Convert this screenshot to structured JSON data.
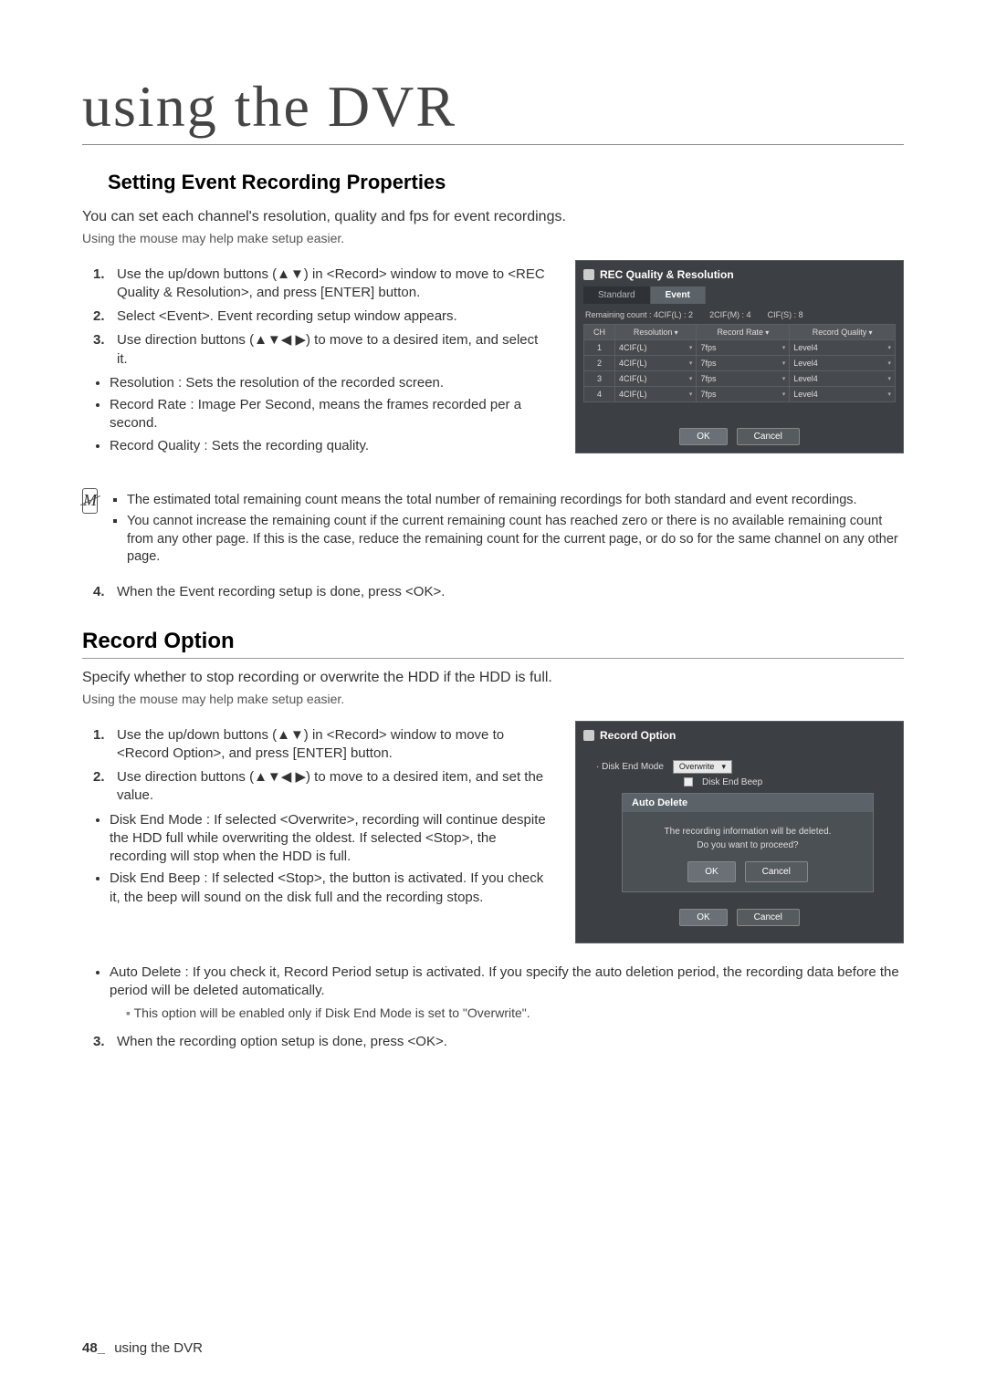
{
  "page": {
    "title": "using the DVR",
    "footer_page": "48_",
    "footer_text": "using the DVR"
  },
  "section1": {
    "heading": "Setting Event Recording Properties",
    "intro": "You can set each channel's resolution, quality and fps for event recordings.",
    "mouse_note": "Using the mouse may help make setup easier.",
    "steps": [
      {
        "n": "1.",
        "text": "Use the up/down buttons (▲▼) in <Record> window to move to <REC Quality & Resolution>, and press [ENTER] button."
      },
      {
        "n": "2.",
        "text": "Select <Event>. Event recording setup window appears."
      },
      {
        "n": "3.",
        "text": "Use direction buttons (▲▼◀ ▶) to move to a desired item, and select it."
      }
    ],
    "bullets": [
      "Resolution : Sets the resolution of the recorded screen.",
      "Record Rate : Image Per Second, means the frames recorded per a second.",
      "Record Quality : Sets the recording quality."
    ],
    "notes": [
      "The estimated total remaining count means the total number of remaining recordings for both standard and event recordings.",
      "You cannot increase the remaining count if the current remaining count has reached zero or there is no available remaining count from any other page. If this is the case, reduce the remaining count for the current page, or do so for the same channel on any other page."
    ],
    "step4": {
      "n": "4.",
      "text": "When the Event recording setup is done, press <OK>."
    }
  },
  "panel1": {
    "title": "REC Quality & Resolution",
    "tabs": {
      "standard": "Standard",
      "event": "Event"
    },
    "counts": {
      "a": "Remaining count : 4CIF(L) : 2",
      "b": "2CIF(M) : 4",
      "c": "CIF(S) : 8"
    },
    "headers": {
      "ch": "CH",
      "res": "Resolution",
      "rate": "Record Rate",
      "quality": "Record Quality"
    },
    "rows": [
      {
        "ch": "1",
        "res": "4CIF(L)",
        "rate": "7fps",
        "quality": "Level4"
      },
      {
        "ch": "2",
        "res": "4CIF(L)",
        "rate": "7fps",
        "quality": "Level4"
      },
      {
        "ch": "3",
        "res": "4CIF(L)",
        "rate": "7fps",
        "quality": "Level4"
      },
      {
        "ch": "4",
        "res": "4CIF(L)",
        "rate": "7fps",
        "quality": "Level4"
      }
    ],
    "ok": "OK",
    "cancel": "Cancel"
  },
  "section2": {
    "heading": "Record Option",
    "intro": "Specify whether to stop recording or overwrite the HDD if the HDD is full.",
    "mouse_note": "Using the mouse may help make setup easier.",
    "steps": [
      {
        "n": "1.",
        "text": "Use the up/down buttons (▲▼) in <Record> window to move to <Record Option>, and press [ENTER] button."
      },
      {
        "n": "2.",
        "text": "Use direction buttons (▲▼◀ ▶) to move to a desired item, and set the value."
      }
    ],
    "bullets": [
      "Disk End Mode : If selected <Overwrite>, recording will continue despite the HDD full while overwriting the oldest. If selected <Stop>, the recording will stop when the HDD is full.",
      "Disk End Beep : If selected <Stop>, the button is activated. If you check it, the beep will sound on the disk full and the recording stops.",
      "Auto Delete : If you check it, Record Period setup is activated. If you specify the auto deletion period, the recording data before the period will be deleted automatically."
    ],
    "indent_note": "This option will be enabled only if Disk End Mode is set to \"Overwrite\".",
    "step3": {
      "n": "3.",
      "text": "When the recording option setup is done, press <OK>."
    }
  },
  "panel2": {
    "title": "Record Option",
    "disk_end_mode_label": "Disk End Mode",
    "disk_end_mode_value": "Overwrite",
    "disk_end_beep_label": "Disk End Beep",
    "modal": {
      "title": "Auto Delete",
      "line1": "The recording information will be deleted.",
      "line2": "Do you want to proceed?",
      "ok": "OK",
      "cancel": "Cancel"
    },
    "ok": "OK",
    "cancel": "Cancel"
  }
}
